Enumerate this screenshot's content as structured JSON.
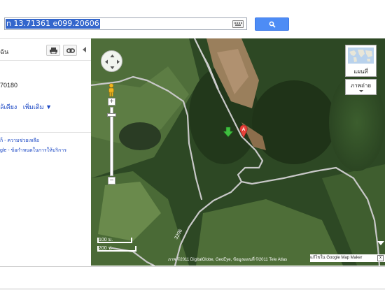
{
  "search": {
    "query": "n 13.71361 e099.20606"
  },
  "icons": {
    "keyboard": "keyboard-icon",
    "search": "magnifier-icon",
    "print": "printer-icon",
    "link": "chain-link-icon"
  },
  "left_panel": {
    "top_label": "ฉัน",
    "postal": "70180",
    "links": [
      "ล้เคียง",
      "เพิ่มเติม ▼"
    ],
    "help_line1": "ก็ - ความช่วยเหลือ",
    "help_line2": "gle - ข้อกำหนดในการให้บริการ"
  },
  "map": {
    "maptype_label": "แผนที่",
    "satellite_label": "ภาพถ่าย",
    "zoom_in": "+",
    "zoom_out": "−",
    "scale_metric": "100 ม.",
    "scale_imperial": "200 ฟุ",
    "marker_label": "A",
    "attribution": "ภาพ ©2011 DigitalGlobe, GeoEye, ข้อมูลแผนที่ ©2011 Tele Atlas",
    "mapmaker_text": "แก้ไขใน Google Map Maker",
    "mapmaker_close": "x",
    "road_label": "3206"
  },
  "colors": {
    "search_button": "#4d8cf5",
    "query_highlight": "#3366cc",
    "marker": "#e8423b",
    "arrow": "#3fbf3f",
    "road": "#c8c8c8",
    "forest": "#2e4a24"
  }
}
